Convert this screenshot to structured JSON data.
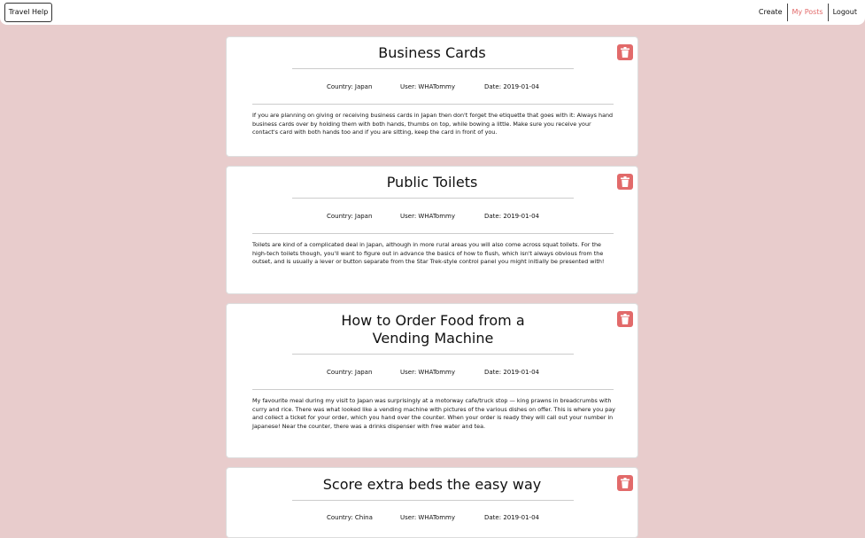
{
  "navbar": {
    "brand": "Travel Help",
    "links": [
      {
        "label": "Create"
      },
      {
        "label": "My Posts"
      },
      {
        "label": "Logout"
      }
    ]
  },
  "posts": [
    {
      "title": "Business Cards",
      "country": "Country: Japan",
      "user": "User: WHATommy",
      "date": "Date: 2019-01-04",
      "body": "If you are planning on giving or receiving business cards in Japan then don't forget the etiquette that goes with it: Always hand business cards over by holding them with both hands, thumbs on top, while bowing a little. Make sure you receive your contact's card with both hands too and if you are sitting, keep the card in front of you."
    },
    {
      "title": "Public Toilets",
      "country": "Country: Japan",
      "user": "User: WHATommy",
      "date": "Date: 2019-01-04",
      "body": "Toilets are kind of a complicated deal in Japan, although in more rural areas you will also come across squat toilets. For the high-tech toilets though, you'll want to figure out in advance the basics of how to flush, which isn't always obvious from the outset, and is usually a lever or button separate from the Star Trek-style control panel you might initially be presented with!"
    },
    {
      "title": "How to Order Food from a Vending Machine",
      "country": "Country: Japan",
      "user": "User: WHATommy",
      "date": "Date: 2019-01-04",
      "body": "My favourite meal during my visit to Japan was surprisingly at a motorway cafe/truck stop — king prawns in breadcrumbs with curry and rice. There was what looked like a vending machine with pictures of the various dishes on offer. This is where you pay and collect a ticket for your order, which you hand over the counter. When your order is ready they will call out your number in Japanese! Near the counter, there was a drinks dispenser with free water and tea."
    },
    {
      "title": "Score extra beds the easy way",
      "country": "Country: China",
      "user": "User: WHATommy",
      "date": "Date: 2019-01-04",
      "body": ""
    }
  ],
  "colors": {
    "background": "#e8cccc",
    "accent": "#e26a6a",
    "card": "#ffffff"
  },
  "icons": {
    "delete": "trash-icon"
  }
}
